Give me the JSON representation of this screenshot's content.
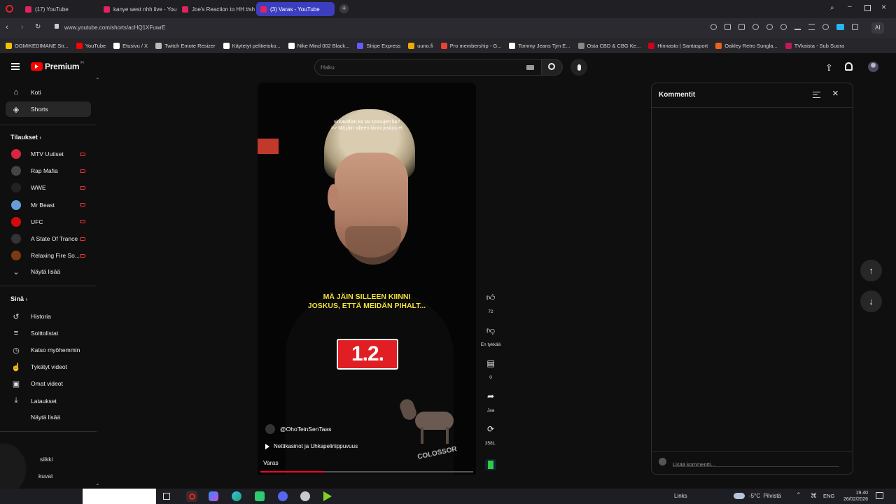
{
  "browser": {
    "tabs": [
      {
        "title": "(17) YouTube",
        "active": false
      },
      {
        "title": "kanye west nhh live - You",
        "active": false
      },
      {
        "title": "Joe's Reaction to HH #sh",
        "active": false
      },
      {
        "title": "(3) Varas - YouTube",
        "active": true
      }
    ],
    "url": "www.youtube.com/shorts/acHQ1XFuwrE",
    "ai_label": "AI",
    "bookmarks": [
      {
        "label": "OGMIKEDIMANE Str...",
        "color": "#f2c200"
      },
      {
        "label": "YouTube",
        "color": "#ff0000"
      },
      {
        "label": "Etusivu / X",
        "color": "#ffffff"
      },
      {
        "label": "Twitch Emote Resizer",
        "color": "#bbbbbb"
      },
      {
        "label": "Käytetyt pelitietoko...",
        "color": "#ffffff"
      },
      {
        "label": "Nike Mind 002 Black...",
        "color": "#ffffff"
      },
      {
        "label": "Stripe Express",
        "color": "#635bff"
      },
      {
        "label": "uuno.fi",
        "color": "#f2a900"
      },
      {
        "label": "Pro membership - G...",
        "color": "#ea4335"
      },
      {
        "label": "Tommy Jeans Tjm E...",
        "color": "#ffffff"
      },
      {
        "label": "Osta CBD & CBG Ke...",
        "color": "#888888"
      },
      {
        "label": "Hinnasto | Santasport",
        "color": "#d0021b"
      },
      {
        "label": "Oakley Retro Sungla...",
        "color": "#e8641b"
      },
      {
        "label": "TVkaista - Sub Suora",
        "color": "#c2185b"
      }
    ]
  },
  "youtube": {
    "logo_text": "Premium",
    "logo_sup": "FI",
    "search_placeholder": "Haku",
    "sidebar": {
      "top": [
        {
          "label": "Koti",
          "icon": "home-icon"
        },
        {
          "label": "Shorts",
          "icon": "shorts-icon",
          "active": true
        }
      ],
      "subscriptions_title": "Tilaukset",
      "subscriptions": [
        {
          "label": "MTV Uutiset",
          "color": "#d7263d"
        },
        {
          "label": "Rap Mafia",
          "color": "#444444"
        },
        {
          "label": "WWE",
          "color": "#222222"
        },
        {
          "label": "Mr Beast",
          "color": "#6a9bd8"
        },
        {
          "label": "UFC",
          "color": "#d20a0a"
        },
        {
          "label": "A State Of Trance",
          "color": "#333333"
        },
        {
          "label": "Relaxing Fire So...",
          "color": "#7a3b12"
        }
      ],
      "show_more": "Näytä lisää",
      "you_title": "Sinä",
      "you_items": [
        {
          "label": "Historia",
          "icon": "history-icon"
        },
        {
          "label": "Soittolistat",
          "icon": "playlist-icon"
        },
        {
          "label": "Katso myöhemmin",
          "icon": "clock-icon"
        },
        {
          "label": "Tykätyt videot",
          "icon": "like-icon"
        },
        {
          "label": "Omat videot",
          "icon": "video-icon"
        },
        {
          "label": "Lataukset",
          "icon": "download-icon"
        }
      ],
      "show_more_2": "Näytä lisää",
      "partial_items": [
        "siikki",
        "kuvat"
      ]
    },
    "short": {
      "top_caption_1": "virkavallan ka tai sossujen ka?",
      "top_caption_2": ">> Mä jäin silleen kiinni joskus et",
      "subtitle_1": "MÄ JÄIN SILLEEN KIINNI",
      "subtitle_2": "JOSKUS, ETTÄ MEIDÄN PIHALT...",
      "badge": "1.2.",
      "watermark": "COLOSSOR",
      "channel": "@OhoTeinSenTaas",
      "playlist": "Nettikasinot ja Uhkapeliriippuvuus",
      "title": "Varas",
      "progress": 0.3
    },
    "actions": [
      {
        "icon": "thumbs-up-icon",
        "label": "72"
      },
      {
        "icon": "thumbs-down-icon",
        "label": "En tykkää"
      },
      {
        "icon": "comment-icon",
        "label": "0"
      },
      {
        "icon": "share-icon",
        "label": "Jaa"
      },
      {
        "icon": "remix-icon",
        "label": "3581."
      }
    ],
    "comments": {
      "title": "Kommentit",
      "add_placeholder": "Lisää kommentti..."
    }
  },
  "taskbar": {
    "links": "Links",
    "weather": "-5°C  Pilvistä",
    "lang": "ENG",
    "time": "19.40",
    "date": "26/02/2026"
  }
}
